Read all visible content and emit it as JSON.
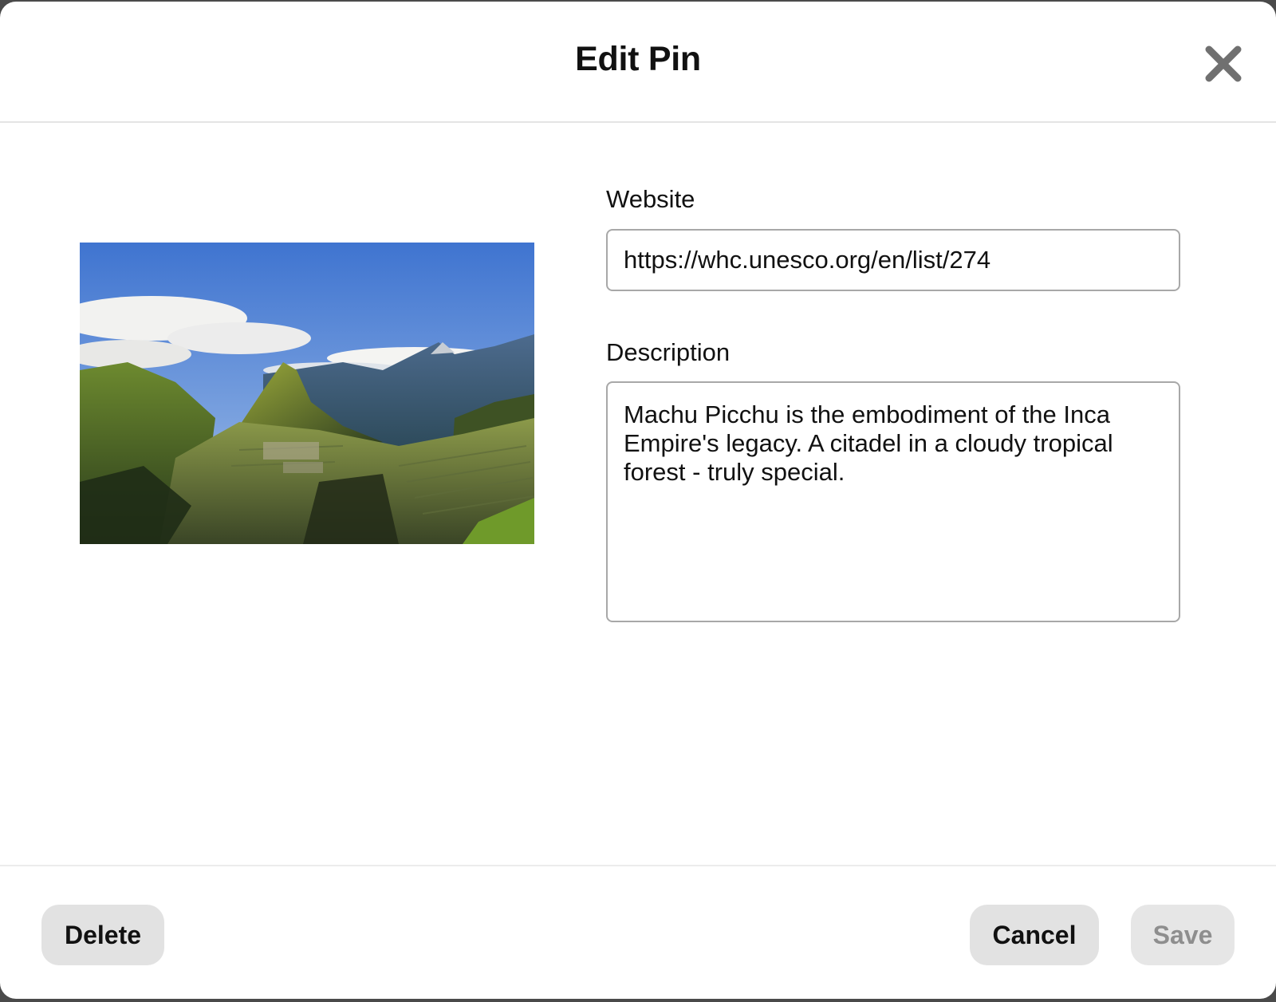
{
  "dialog": {
    "title": "Edit Pin",
    "close_icon": "close-icon"
  },
  "pin": {
    "image_alt": "Machu Picchu"
  },
  "form": {
    "website_label": "Website",
    "website_value": "https://whc.unesco.org/en/list/274",
    "description_label": "Description",
    "description_value": "Machu Picchu is the embodiment of the Inca Empire's legacy. A citadel in a cloudy tropical forest - truly special."
  },
  "footer": {
    "delete_label": "Delete",
    "cancel_label": "Cancel",
    "save_label": "Save",
    "save_disabled": true
  },
  "colors": {
    "button_bg": "#e2e2e2",
    "disabled_text": "#8e8e8e",
    "border": "#a8a8a8"
  }
}
